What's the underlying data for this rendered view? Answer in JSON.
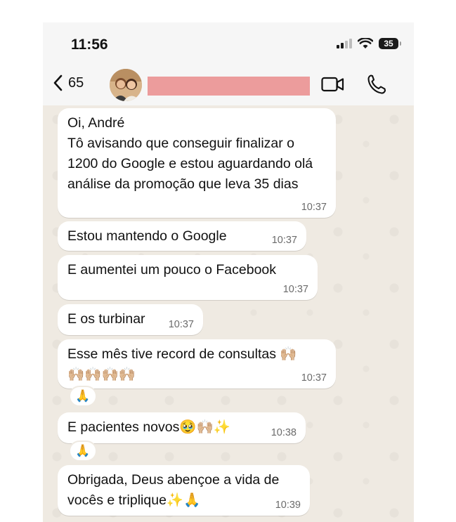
{
  "status_bar": {
    "time": "11:56",
    "battery": "35"
  },
  "header": {
    "back_count": "65",
    "contact_name_redacted": true,
    "accent_redaction_color": "#ec9c9c"
  },
  "icons": {
    "back": "chevron-left-icon",
    "video": "video-camera-icon",
    "call": "phone-icon",
    "wifi": "wifi-icon",
    "signal": "cellular-signal-icon",
    "battery": "battery-icon"
  },
  "messages": [
    {
      "text": "Oi, André\nTô avisando que conseguir finalizar o 1200 do Google e estou aguardando olá análise da promoção que leva 35 dias",
      "time": "10:37"
    },
    {
      "text": "Estou mantendo o Google",
      "time": "10:37"
    },
    {
      "text": "E aumentei um pouco o Facebook",
      "time": "10:37"
    },
    {
      "text": "E os turbinar",
      "time": "10:37"
    },
    {
      "text": "Esse mês tive record de consultas 🙌🏼\n🙌🏼🙌🏼🙌🏼🙌🏼",
      "time": "10:37",
      "reaction": "🙏"
    },
    {
      "text": "E pacientes novos🥹🙌🏼✨",
      "time": "10:38",
      "reaction": "🙏"
    },
    {
      "text": "Obrigada, Deus abençoe a vida de vocês e triplique✨🙏",
      "time": "10:39"
    }
  ]
}
